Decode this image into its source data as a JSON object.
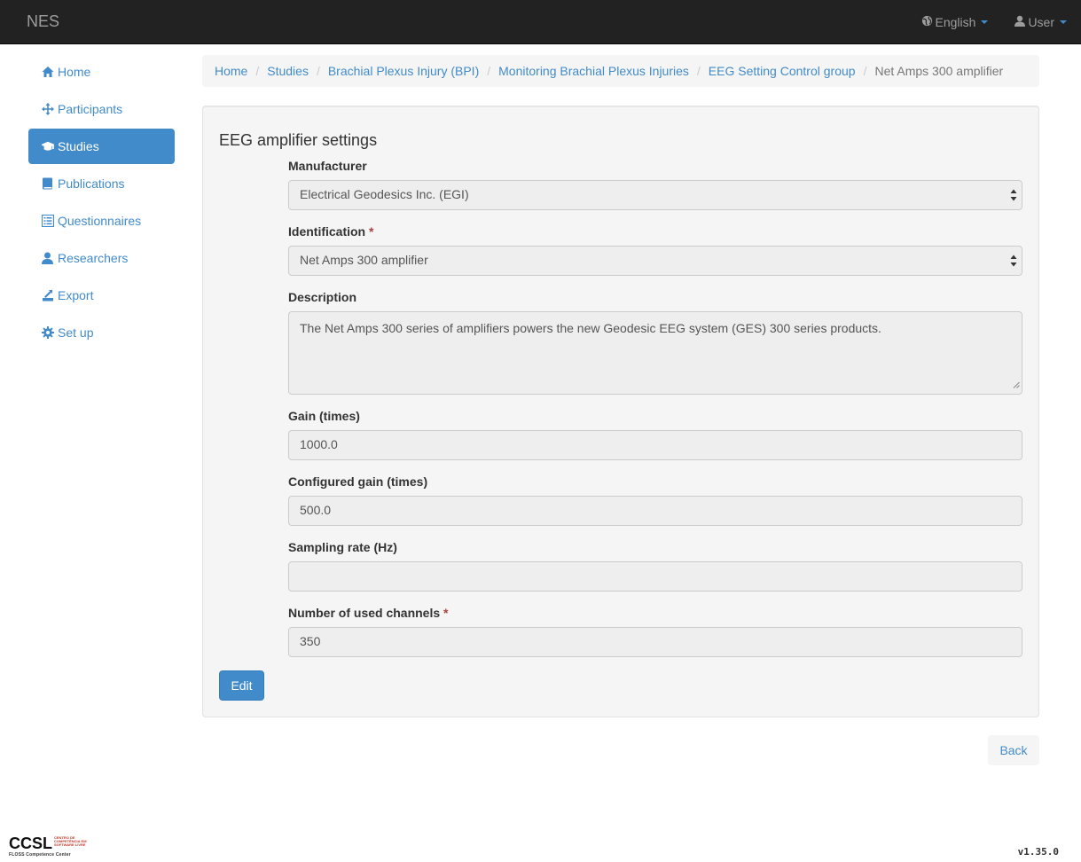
{
  "navbar": {
    "brand": "NES",
    "language_label": "English",
    "user_label": "User"
  },
  "sidebar": {
    "items": [
      {
        "label": "Home",
        "icon": "home-icon"
      },
      {
        "label": "Participants",
        "icon": "move-icon"
      },
      {
        "label": "Studies",
        "icon": "education-icon",
        "active": true
      },
      {
        "label": "Publications",
        "icon": "book-icon"
      },
      {
        "label": "Questionnaires",
        "icon": "list-alt-icon"
      },
      {
        "label": "Researchers",
        "icon": "user-icon"
      },
      {
        "label": "Export",
        "icon": "export-icon"
      },
      {
        "label": "Set up",
        "icon": "cog-icon"
      }
    ]
  },
  "breadcrumb": [
    "Home",
    "Studies",
    "Brachial Plexus Injury (BPI)",
    "Monitoring Brachial Plexus Injuries",
    "EEG Setting Control group",
    "Net Amps 300 amplifier"
  ],
  "form": {
    "title": "EEG amplifier settings",
    "manufacturer": {
      "label": "Manufacturer",
      "value": "Electrical Geodesics Inc. (EGI)"
    },
    "identification": {
      "label": "Identification",
      "required": "*",
      "value": "Net Amps 300 amplifier"
    },
    "description": {
      "label": "Description",
      "value": "The Net Amps 300 series of amplifiers powers the new Geodesic EEG system (GES) 300 series products."
    },
    "gain": {
      "label": "Gain (times)",
      "value": "1000.0"
    },
    "configured_gain": {
      "label": "Configured gain (times)",
      "value": "500.0"
    },
    "sampling_rate": {
      "label": "Sampling rate (Hz)",
      "value": ""
    },
    "channels": {
      "label": "Number of used channels",
      "required": "*",
      "value": "350"
    },
    "edit_label": "Edit"
  },
  "back_label": "Back",
  "footer": {
    "logo_text": "CCSL",
    "logo_small_lines": [
      "CENTRO DE",
      "COMPETÊNCIA EM",
      "SOFTWARE LIVRE"
    ],
    "logo_subtitle": "FLOSS Competence Center",
    "version": "v1.35.0"
  },
  "colors": {
    "navbar_bg": "#222222",
    "link": "#428bca",
    "active_bg": "#428bca",
    "well_bg": "#f5f5f5",
    "input_disabled_bg": "#eeeeee",
    "required": "#a94442"
  }
}
